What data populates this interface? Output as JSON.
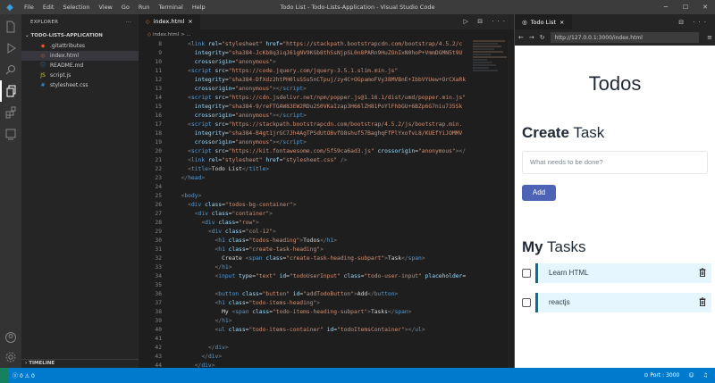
{
  "titlebar": {
    "menu": [
      "File",
      "Edit",
      "Selection",
      "View",
      "Go",
      "Run",
      "Terminal",
      "Help"
    ],
    "title": "Todo List - Todo-Lists-Application - Visual Studio Code"
  },
  "sidebar": {
    "explorer_label": "EXPLORER",
    "more": "···",
    "folder": "TODO-LISTS-APPLICATION",
    "files": [
      {
        "name": ".gitattributes",
        "icon": "git-icon",
        "color": "#f14c28"
      },
      {
        "name": "index.html",
        "icon": "html-icon",
        "color": "#e37933"
      },
      {
        "name": "README.md",
        "icon": "info-icon",
        "color": "#42a5f5"
      },
      {
        "name": "script.js",
        "icon": "js-icon",
        "color": "#cbcb41"
      },
      {
        "name": "stylesheet.css",
        "icon": "css-icon",
        "color": "#42a5f5"
      }
    ],
    "timeline": "TIMELINE"
  },
  "editor": {
    "tab_label": "index.html",
    "tab_close": "×",
    "breadcrumb": "index.html",
    "breadcrumb_tail": "> ...",
    "actions": "▷ ⊟ ···",
    "lines": [
      {
        "n": "8",
        "ind": 2,
        "toks": [
          [
            "t-pun",
            "<"
          ],
          [
            "t-tag",
            "link "
          ],
          [
            "t-attr",
            "rel"
          ],
          [
            "t-txt",
            "="
          ],
          [
            "t-str",
            "\"stylesheet\" "
          ],
          [
            "t-attr",
            "href"
          ],
          [
            "t-txt",
            "="
          ],
          [
            "t-str",
            "\"https://stackpath.bootstrapcdn.com/bootstrap/4.5.2/c"
          ]
        ]
      },
      {
        "n": "9",
        "ind": 3,
        "toks": [
          [
            "t-attr",
            "integrity"
          ],
          [
            "t-txt",
            "="
          ],
          [
            "t-str",
            "\"sha384-JcKb8q3iqJ61gNV9KGb8thSsNjpSL0n8PARn9HuZOnIxN0hoP+VmmDGMN5t9U"
          ]
        ]
      },
      {
        "n": "10",
        "ind": 3,
        "toks": [
          [
            "t-attr",
            "crossorigin"
          ],
          [
            "t-txt",
            "="
          ],
          [
            "t-str",
            "\"anonymous\""
          ],
          [
            "t-pun",
            ">"
          ]
        ]
      },
      {
        "n": "11",
        "ind": 2,
        "toks": [
          [
            "t-pun",
            "<"
          ],
          [
            "t-tag",
            "script "
          ],
          [
            "t-attr",
            "src"
          ],
          [
            "t-txt",
            "="
          ],
          [
            "t-str",
            "\"https://code.jquery.com/jquery-3.5.1.slim.min.js\""
          ]
        ]
      },
      {
        "n": "12",
        "ind": 3,
        "toks": [
          [
            "t-attr",
            "integrity"
          ],
          [
            "t-txt",
            "="
          ],
          [
            "t-str",
            "\"sha384-DfXdz2htPH0lsSSs5nCTpuj/zy4C+OGpamoFVy38MVBnE+IbbVYUew+OrCXaRk"
          ]
        ]
      },
      {
        "n": "13",
        "ind": 3,
        "toks": [
          [
            "t-attr",
            "crossorigin"
          ],
          [
            "t-txt",
            "="
          ],
          [
            "t-str",
            "\"anonymous\""
          ],
          [
            "t-pun",
            "></"
          ],
          [
            "t-tag",
            "script"
          ],
          [
            "t-pun",
            ">"
          ]
        ]
      },
      {
        "n": "14",
        "ind": 2,
        "toks": [
          [
            "t-pun",
            "<"
          ],
          [
            "t-tag",
            "script "
          ],
          [
            "t-attr",
            "src"
          ],
          [
            "t-txt",
            "="
          ],
          [
            "t-str",
            "\"https://cdn.jsdelivr.net/npm/popper.js@1.16.1/dist/umd/popper.min.js\""
          ]
        ]
      },
      {
        "n": "15",
        "ind": 3,
        "toks": [
          [
            "t-attr",
            "integrity"
          ],
          [
            "t-txt",
            "="
          ],
          [
            "t-str",
            "\"sha384-9/reFTGAW83EW2RDu2S0VKaIzap3H66lZH81PoYlFhbGU+6BZp6G7niu735Sk"
          ]
        ]
      },
      {
        "n": "16",
        "ind": 3,
        "toks": [
          [
            "t-attr",
            "crossorigin"
          ],
          [
            "t-txt",
            "="
          ],
          [
            "t-str",
            "\"anonymous\""
          ],
          [
            "t-pun",
            "></"
          ],
          [
            "t-tag",
            "script"
          ],
          [
            "t-pun",
            ">"
          ]
        ]
      },
      {
        "n": "17",
        "ind": 2,
        "toks": [
          [
            "t-pun",
            "<"
          ],
          [
            "t-tag",
            "script "
          ],
          [
            "t-attr",
            "src"
          ],
          [
            "t-txt",
            "="
          ],
          [
            "t-str",
            "\"https://stackpath.bootstrapcdn.com/bootstrap/4.5.2/js/bootstrap.min."
          ]
        ]
      },
      {
        "n": "18",
        "ind": 3,
        "toks": [
          [
            "t-attr",
            "integrity"
          ],
          [
            "t-txt",
            "="
          ],
          [
            "t-str",
            "\"sha384-B4gt1jrGC7Jh4AgTPSdUtOBvfO8shuf57BaghqFfPlYxofvL8/KUEfYiJOMMV"
          ]
        ]
      },
      {
        "n": "19",
        "ind": 3,
        "toks": [
          [
            "t-attr",
            "crossorigin"
          ],
          [
            "t-txt",
            "="
          ],
          [
            "t-str",
            "\"anonymous\""
          ],
          [
            "t-pun",
            "></"
          ],
          [
            "t-tag",
            "script"
          ],
          [
            "t-pun",
            ">"
          ]
        ]
      },
      {
        "n": "20",
        "ind": 2,
        "toks": [
          [
            "t-pun",
            "<"
          ],
          [
            "t-tag",
            "script "
          ],
          [
            "t-attr",
            "src"
          ],
          [
            "t-txt",
            "="
          ],
          [
            "t-str",
            "\"https://kit.fontawesome.com/5f59ca6ad3.js\" "
          ],
          [
            "t-attr",
            "crossorigin"
          ],
          [
            "t-txt",
            "="
          ],
          [
            "t-str",
            "\"anonymous\""
          ],
          [
            "t-pun",
            "></"
          ]
        ]
      },
      {
        "n": "21",
        "ind": 2,
        "toks": [
          [
            "t-pun",
            "<"
          ],
          [
            "t-tag",
            "link "
          ],
          [
            "t-attr",
            "rel"
          ],
          [
            "t-txt",
            "="
          ],
          [
            "t-str",
            "\"stylesheet\" "
          ],
          [
            "t-attr",
            "href"
          ],
          [
            "t-txt",
            "="
          ],
          [
            "t-str",
            "\"stylesheet.css\" "
          ],
          [
            "t-pun",
            "/>"
          ]
        ]
      },
      {
        "n": "22",
        "ind": 2,
        "toks": [
          [
            "t-pun",
            "<"
          ],
          [
            "t-tag",
            "title"
          ],
          [
            "t-pun",
            ">"
          ],
          [
            "t-txt",
            "Todo List"
          ],
          [
            "t-pun",
            "</"
          ],
          [
            "t-tag",
            "title"
          ],
          [
            "t-pun",
            ">"
          ]
        ]
      },
      {
        "n": "23",
        "ind": 1,
        "toks": [
          [
            "t-pun",
            "</"
          ],
          [
            "t-tag",
            "head"
          ],
          [
            "t-pun",
            ">"
          ]
        ]
      },
      {
        "n": "24",
        "ind": 0,
        "toks": []
      },
      {
        "n": "25",
        "ind": 1,
        "toks": [
          [
            "t-pun",
            "<"
          ],
          [
            "t-tag",
            "body"
          ],
          [
            "t-pun",
            ">"
          ]
        ]
      },
      {
        "n": "26",
        "ind": 2,
        "toks": [
          [
            "t-pun",
            "<"
          ],
          [
            "t-tag",
            "div "
          ],
          [
            "t-attr",
            "class"
          ],
          [
            "t-txt",
            "="
          ],
          [
            "t-str",
            "\"todos-bg-container\""
          ],
          [
            "t-pun",
            ">"
          ]
        ]
      },
      {
        "n": "27",
        "ind": 3,
        "toks": [
          [
            "t-pun",
            "<"
          ],
          [
            "t-tag",
            "div "
          ],
          [
            "t-attr",
            "class"
          ],
          [
            "t-txt",
            "="
          ],
          [
            "t-str",
            "\"container\""
          ],
          [
            "t-pun",
            ">"
          ]
        ]
      },
      {
        "n": "28",
        "ind": 4,
        "toks": [
          [
            "t-pun",
            "<"
          ],
          [
            "t-tag",
            "div "
          ],
          [
            "t-attr",
            "class"
          ],
          [
            "t-txt",
            "="
          ],
          [
            "t-str",
            "\"row\""
          ],
          [
            "t-pun",
            ">"
          ]
        ]
      },
      {
        "n": "29",
        "ind": 5,
        "toks": [
          [
            "t-pun",
            "<"
          ],
          [
            "t-tag",
            "div "
          ],
          [
            "t-attr",
            "class"
          ],
          [
            "t-txt",
            "="
          ],
          [
            "t-str",
            "\"col-12\""
          ],
          [
            "t-pun",
            ">"
          ]
        ]
      },
      {
        "n": "30",
        "ind": 6,
        "toks": [
          [
            "t-pun",
            "<"
          ],
          [
            "t-tag",
            "h1 "
          ],
          [
            "t-attr",
            "class"
          ],
          [
            "t-txt",
            "="
          ],
          [
            "t-str",
            "\"todos-heading\""
          ],
          [
            "t-pun",
            ">"
          ],
          [
            "t-txt",
            "Todos"
          ],
          [
            "t-pun",
            "</"
          ],
          [
            "t-tag",
            "h1"
          ],
          [
            "t-pun",
            ">"
          ]
        ]
      },
      {
        "n": "31",
        "ind": 6,
        "toks": [
          [
            "t-pun",
            "<"
          ],
          [
            "t-tag",
            "h1 "
          ],
          [
            "t-attr",
            "class"
          ],
          [
            "t-txt",
            "="
          ],
          [
            "t-str",
            "\"create-task-heading\""
          ],
          [
            "t-pun",
            ">"
          ]
        ]
      },
      {
        "n": "32",
        "ind": 7,
        "toks": [
          [
            "t-txt",
            "Create "
          ],
          [
            "t-pun",
            "<"
          ],
          [
            "t-tag",
            "span "
          ],
          [
            "t-attr",
            "class"
          ],
          [
            "t-txt",
            "="
          ],
          [
            "t-str",
            "\"create-task-heading-subpart\""
          ],
          [
            "t-pun",
            ">"
          ],
          [
            "t-txt",
            "Task"
          ],
          [
            "t-pun",
            "</"
          ],
          [
            "t-tag",
            "span"
          ],
          [
            "t-pun",
            ">"
          ]
        ]
      },
      {
        "n": "33",
        "ind": 6,
        "toks": [
          [
            "t-pun",
            "</"
          ],
          [
            "t-tag",
            "h1"
          ],
          [
            "t-pun",
            ">"
          ]
        ]
      },
      {
        "n": "34",
        "ind": 6,
        "toks": [
          [
            "t-pun",
            "<"
          ],
          [
            "t-tag",
            "input "
          ],
          [
            "t-attr",
            "type"
          ],
          [
            "t-txt",
            "="
          ],
          [
            "t-str",
            "\"text\" "
          ],
          [
            "t-attr",
            "id"
          ],
          [
            "t-txt",
            "="
          ],
          [
            "t-str",
            "\"todoUserInput\" "
          ],
          [
            "t-attr",
            "class"
          ],
          [
            "t-txt",
            "="
          ],
          [
            "t-str",
            "\"todo-user-input\" "
          ],
          [
            "t-attr",
            "placeholder"
          ],
          [
            "t-txt",
            "="
          ]
        ]
      },
      {
        "n": "35",
        "ind": 0,
        "toks": []
      },
      {
        "n": "36",
        "ind": 6,
        "toks": [
          [
            "t-pun",
            "<"
          ],
          [
            "t-tag",
            "button "
          ],
          [
            "t-attr",
            "class"
          ],
          [
            "t-txt",
            "="
          ],
          [
            "t-str",
            "\"button\" "
          ],
          [
            "t-attr",
            "id"
          ],
          [
            "t-txt",
            "="
          ],
          [
            "t-str",
            "\"addTodoButton\""
          ],
          [
            "t-pun",
            ">"
          ],
          [
            "t-txt",
            "Add"
          ],
          [
            "t-pun",
            "</"
          ],
          [
            "t-tag",
            "button"
          ],
          [
            "t-pun",
            ">"
          ]
        ]
      },
      {
        "n": "37",
        "ind": 6,
        "toks": [
          [
            "t-pun",
            "<"
          ],
          [
            "t-tag",
            "h1 "
          ],
          [
            "t-attr",
            "class"
          ],
          [
            "t-txt",
            "="
          ],
          [
            "t-str",
            "\"todo-items-heading\""
          ],
          [
            "t-pun",
            ">"
          ]
        ]
      },
      {
        "n": "38",
        "ind": 7,
        "toks": [
          [
            "t-txt",
            "My "
          ],
          [
            "t-pun",
            "<"
          ],
          [
            "t-tag",
            "span "
          ],
          [
            "t-attr",
            "class"
          ],
          [
            "t-txt",
            "="
          ],
          [
            "t-str",
            "\"todo-items-heading-subpart\""
          ],
          [
            "t-pun",
            ">"
          ],
          [
            "t-txt",
            "Tasks"
          ],
          [
            "t-pun",
            "</"
          ],
          [
            "t-tag",
            "span"
          ],
          [
            "t-pun",
            ">"
          ]
        ]
      },
      {
        "n": "39",
        "ind": 6,
        "toks": [
          [
            "t-pun",
            "</"
          ],
          [
            "t-tag",
            "h1"
          ],
          [
            "t-pun",
            ">"
          ]
        ]
      },
      {
        "n": "40",
        "ind": 6,
        "toks": [
          [
            "t-pun",
            "<"
          ],
          [
            "t-tag",
            "ul "
          ],
          [
            "t-attr",
            "class"
          ],
          [
            "t-txt",
            "="
          ],
          [
            "t-str",
            "\"todo-items-container\" "
          ],
          [
            "t-attr",
            "id"
          ],
          [
            "t-txt",
            "="
          ],
          [
            "t-str",
            "\"todoItemsContainer\""
          ],
          [
            "t-pun",
            "></"
          ],
          [
            "t-tag",
            "ul"
          ],
          [
            "t-pun",
            ">"
          ]
        ]
      },
      {
        "n": "41",
        "ind": 0,
        "toks": []
      },
      {
        "n": "42",
        "ind": 5,
        "toks": [
          [
            "t-pun",
            "</"
          ],
          [
            "t-tag",
            "div"
          ],
          [
            "t-pun",
            ">"
          ]
        ]
      },
      {
        "n": "43",
        "ind": 4,
        "toks": [
          [
            "t-pun",
            "</"
          ],
          [
            "t-tag",
            "div"
          ],
          [
            "t-pun",
            ">"
          ]
        ]
      },
      {
        "n": "44",
        "ind": 3,
        "toks": [
          [
            "t-pun",
            "</"
          ],
          [
            "t-tag",
            "div"
          ],
          [
            "t-pun",
            ">"
          ]
        ]
      }
    ]
  },
  "browser": {
    "tab_label": "Todo List",
    "tab_close": "×",
    "actions": "⊟ ···",
    "nav_back": "←",
    "nav_forward": "→",
    "nav_reload": "↻",
    "url": "http://127.0.0.1:3000/index.html",
    "menu": "≡",
    "page": {
      "heading": "Todos",
      "create_bold": "Create",
      "create_rest": " Task",
      "input_placeholder": "What needs to be done?",
      "add_label": "Add",
      "my_bold": "My",
      "my_rest": " Tasks",
      "todos": [
        {
          "label": "Learn HTML",
          "checked": false
        },
        {
          "label": "reactjs",
          "checked": false
        }
      ]
    }
  },
  "statusbar": {
    "errors": "0",
    "warnings": "0",
    "port": "Port : 3000"
  },
  "colors": {
    "statusbar": "#007acc",
    "add_button": "#4c63b6",
    "todo_bg": "#e6f6ff",
    "todo_accent": "#096f92"
  }
}
